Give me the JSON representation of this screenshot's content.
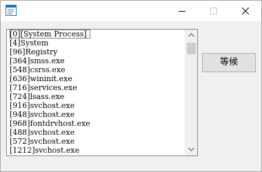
{
  "window": {
    "icon": "app-list-icon",
    "controls": [
      "minimize-icon",
      "maximize-icon",
      "close-icon"
    ]
  },
  "process_list": {
    "items": [
      "[0][System Process]",
      "[4]System",
      "[96]Registry",
      "[364]smss.exe",
      "[548]csrss.exe",
      "[636]wininit.exe",
      "[716]services.exe",
      "[724]lsass.exe",
      "[916]svchost.exe",
      "[948]svchost.exe",
      "[968]fontdrvhost.exe",
      "[488]svchost.exe",
      "[572]svchost.exe",
      "[1212]svchost.exe"
    ]
  },
  "buttons": {
    "wait_label": "等候"
  },
  "colors": {
    "titlebar": "#ffffff",
    "client_bg": "#f0f0f0",
    "button_bg": "#e1e1e1",
    "scroll_thumb": "#cdcdcd"
  }
}
